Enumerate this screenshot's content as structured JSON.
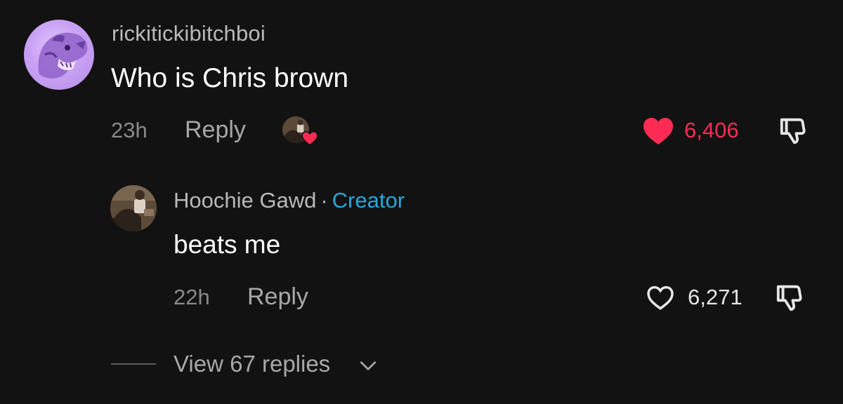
{
  "comment": {
    "username": "rickitickibitchboi",
    "text": "Who is Chris brown",
    "time": "23h",
    "reply_label": "Reply",
    "likes": "6,406",
    "liked": true
  },
  "reply": {
    "username": "Hoochie Gawd",
    "separator": "·",
    "badge": "Creator",
    "text": "beats me",
    "time": "22h",
    "reply_label": "Reply",
    "likes": "6,271",
    "liked": false
  },
  "view_replies": {
    "label": "View 67 replies"
  },
  "colors": {
    "background": "#121212",
    "like_active": "#fe2c55",
    "creator_badge": "#2aa6d9",
    "muted_text": "#b9b9b9"
  },
  "icons": {
    "like_filled": "heart-filled-icon",
    "like_outline": "heart-outline-icon",
    "dislike": "thumbs-down-icon",
    "expand": "chevron-down-icon"
  }
}
